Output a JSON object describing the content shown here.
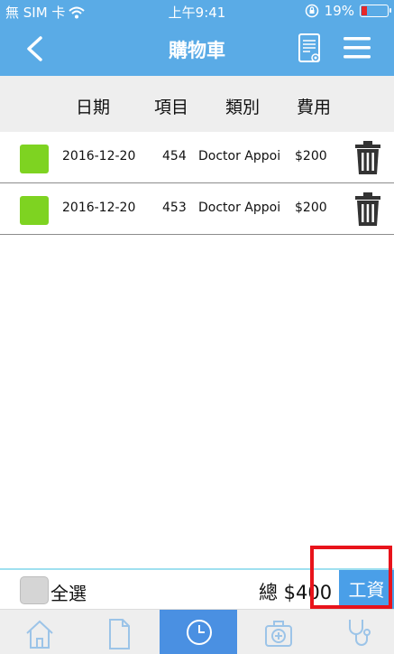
{
  "status_bar": {
    "carrier": "無 SIM 卡",
    "time": "上午9:41",
    "battery": "19%",
    "icons": [
      "wifi-icon",
      "rotation-lock-icon",
      "battery-icon"
    ]
  },
  "nav": {
    "title": "購物車",
    "icons": [
      "back-chevron-icon",
      "document-icon",
      "menu-icon"
    ]
  },
  "table": {
    "headers": [
      "日期",
      "項目",
      "類別",
      "費用"
    ],
    "rows": [
      {
        "date": "2016-12-20",
        "item": "454",
        "category": "Doctor Appoi",
        "fee": "$200",
        "checked": true
      },
      {
        "date": "2016-12-20",
        "item": "453",
        "category": "Doctor Appoi",
        "fee": "$200",
        "checked": true
      }
    ]
  },
  "footer": {
    "select_all": "全選",
    "total": "總 $400",
    "pay": "工資"
  },
  "tab_bar": {
    "tabs": [
      "home-icon",
      "document-icon",
      "clock-icon",
      "medical-kit-icon",
      "stethoscope-icon"
    ],
    "active_index": 2
  },
  "colors": {
    "header_blue": "#5aabe6",
    "active_tab_blue": "#4a90e2",
    "checkbox_green": "#7ed321",
    "highlight_red": "#e8131b",
    "battery_red": "#e62727"
  }
}
